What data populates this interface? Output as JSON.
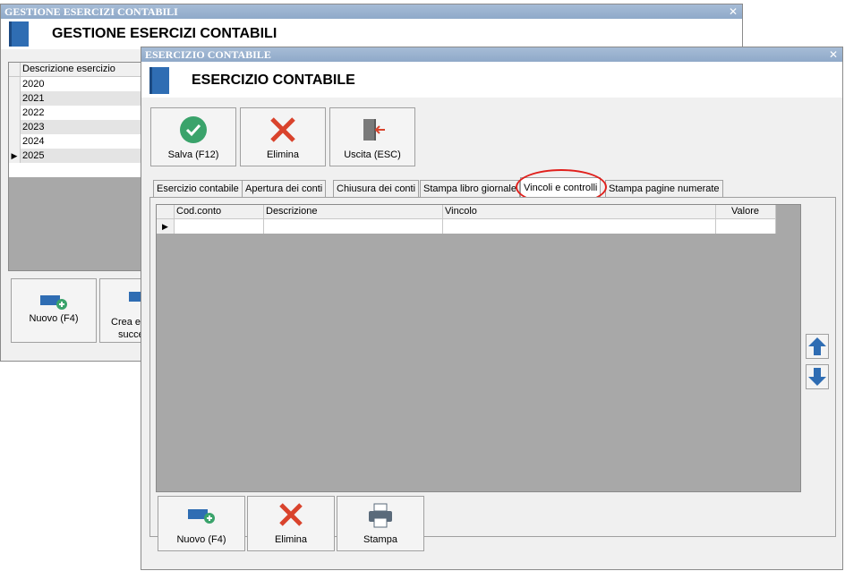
{
  "back_window": {
    "title": "GESTIONE ESERCIZI CONTABILI",
    "header_title": "GESTIONE ESERCIZI CONTABILI",
    "grid_header": "Descrizione esercizio",
    "rows": [
      "2020",
      "2021",
      "2022",
      "2023",
      "2024",
      "2025"
    ],
    "selected_row": "2025",
    "buttons": {
      "nuovo": "Nuovo (F4)",
      "crea_line1": "Crea es",
      "crea_line2": "succe"
    }
  },
  "front_window": {
    "title": "ESERCIZIO CONTABILE",
    "header_title": "ESERCIZIO CONTABILE",
    "toolbar": {
      "salva": "Salva (F12)",
      "elimina": "Elimina",
      "uscita": "Uscita (ESC)"
    },
    "tabs": [
      {
        "label": "Esercizio contabile"
      },
      {
        "label": "Apertura dei conti"
      },
      {
        "label": "Chiusura dei conti"
      },
      {
        "label": "Stampa libro giornale"
      },
      {
        "label": "Vincoli e controlli",
        "active": true
      },
      {
        "label": "Stampa pagine numerate"
      }
    ],
    "grid_columns": [
      "Cod.conto",
      "Descrizione",
      "Vincolo",
      "Valore"
    ],
    "bottom_buttons": {
      "nuovo": "Nuovo (F4)",
      "elimina": "Elimina",
      "stampa": "Stampa"
    }
  },
  "icons": {
    "close": "close-icon",
    "check": "check-icon",
    "delete": "delete-x-icon",
    "exit": "exit-door-icon",
    "new": "new-record-icon",
    "print": "printer-icon",
    "up": "arrow-up-icon",
    "down": "arrow-down-icon"
  },
  "colors": {
    "titlebar": "#9cb4d2",
    "accent_blue": "#2f6db3",
    "check_green": "#3aa36b",
    "delete_red": "#d9432c",
    "highlight_circle": "#e0201c",
    "grid_bg": "#a8a8a8"
  }
}
